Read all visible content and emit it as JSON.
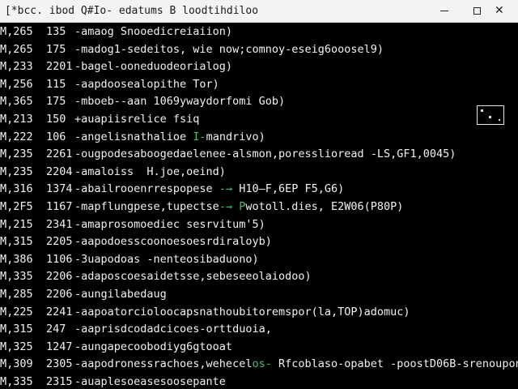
{
  "window": {
    "title": "[*bcc. ibod Q#Io- edatums B loodtihdiloo",
    "controls": {
      "minimize": "minimize",
      "maximize": "maximize",
      "close": "✕"
    }
  },
  "colors": {
    "background": "#000000",
    "text": "#f2f2f2",
    "highlight": "#38c172",
    "titlebar": "#f3f3f3"
  },
  "log": {
    "rows": [
      {
        "time": "M,265",
        "pid": "135",
        "msg_a": "-amaog Snooedicreiaiion)",
        "hl": "",
        "msg_b": ""
      },
      {
        "time": "M,265",
        "pid": "175",
        "msg_a": "-madog1-sedeitos, wie now;comnoy-eseig6ooosel9)",
        "hl": "",
        "msg_b": ""
      },
      {
        "time": "M,233",
        "pid": "2201",
        "msg_a": "-bagel-ooneduodeorialog)",
        "hl": "",
        "msg_b": ""
      },
      {
        "time": "M,256",
        "pid": "115",
        "msg_a": "-aapdoosealopithe Tor)",
        "hl": "",
        "msg_b": ""
      },
      {
        "time": "M,365",
        "pid": "175",
        "msg_a": "-mboeb--aan 1069ywaydorfomi Gob)",
        "hl": "",
        "msg_b": ""
      },
      {
        "time": "M,213",
        "pid": "150",
        "msg_a": "+auapiisrelice fsiq",
        "hl": "",
        "msg_b": ""
      },
      {
        "time": "M,222",
        "pid": "106",
        "msg_a": "-angelisnathalioe ",
        "hl": "I-",
        "msg_b": "mandrivo)"
      },
      {
        "time": "M,235",
        "pid": "2261",
        "msg_a": "-ougpodesaboogedaelenee-alsmon,poresslioread -LS,GF1,0045)",
        "hl": "",
        "msg_b": ""
      },
      {
        "time": "M,235",
        "pid": "2204",
        "msg_a": "-amaloiss  H.joe,oeind)",
        "hl": "",
        "msg_b": ""
      },
      {
        "time": "M,316",
        "pid": "1374",
        "msg_a": "-abailrooenrrespopese ",
        "hl": "-→",
        "msg_b": " H10‒F,6EP F5,G6)"
      },
      {
        "time": "M,2F5",
        "pid": "1167",
        "msg_a": "-mapflungpese,tupectse",
        "hl": "-→ P",
        "msg_b": "wotoll.dies, E2W06(P80P)"
      },
      {
        "time": "M,215",
        "pid": "2341",
        "msg_a": "-amaprosomoediec sesrvitum'5)",
        "hl": "",
        "msg_b": ""
      },
      {
        "time": "M,315",
        "pid": "2205",
        "msg_a": "-aapodoesscoonoesoesrdiraloyb)",
        "hl": "",
        "msg_b": ""
      },
      {
        "time": "M,386",
        "pid": "1106",
        "msg_a": "-3uapodoas -nenteosibaduono)",
        "hl": "",
        "msg_b": ""
      },
      {
        "time": "M,335",
        "pid": "2206",
        "msg_a": "-adaposcoesaidetsse,sebeseeolaiodoo)",
        "hl": "",
        "msg_b": ""
      },
      {
        "time": "M,285",
        "pid": "2206",
        "msg_a": "-aungilabedaug",
        "hl": "",
        "msg_b": ""
      },
      {
        "time": "M,225",
        "pid": "2241",
        "msg_a": "-aapoatorcioloocapsnathoubitoremspor(la,TOP)adomuc)",
        "hl": "",
        "msg_b": ""
      },
      {
        "time": "M,315",
        "pid": "247",
        "msg_a": "-aaprisdcodadcicoes-orttduoia,",
        "hl": "",
        "msg_b": ""
      },
      {
        "time": "M,325",
        "pid": "1247",
        "msg_a": "-aungapecoobodiyg6gtooat",
        "hl": "",
        "msg_b": ""
      },
      {
        "time": "M,309",
        "pid": "2305",
        "msg_a": "-aapodronessrachoes,wehecel",
        "hl": "os-",
        "msg_b": " Rfcoblaso-opabet -poostD06B-srenoupone"
      },
      {
        "time": "M,335",
        "pid": "2315",
        "msg_a": "-auaplesoeasesoosepante",
        "hl": "",
        "msg_b": ""
      }
    ]
  }
}
